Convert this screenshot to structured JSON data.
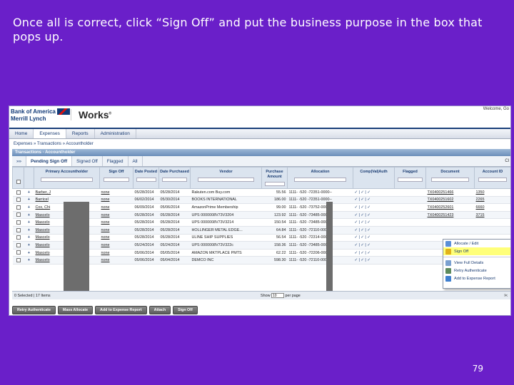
{
  "slide": {
    "title": "Once all is correct, click “Sign Off” and put the business purpose in the box that pops up.",
    "page_number": "79"
  },
  "app": {
    "bank_line1": "Bank of America",
    "bank_line2": "Merrill Lynch",
    "product": "Works",
    "product_mark": "®",
    "welcome": "Welcome, Go"
  },
  "nav": [
    "Home",
    "Expenses",
    "Reports",
    "Administration"
  ],
  "breadcrumb": "Expenses  »  Transactions  »  Accountholder",
  "panel_title": "Transactions - Accountholder",
  "tabs": [
    "»»",
    "Pending Sign Off",
    "Signed Off",
    "Flagged",
    "All"
  ],
  "close_label": "Cl",
  "columns": [
    "",
    "",
    "Primary Accountholder",
    "Sign Off",
    "Date Posted",
    "Date Purchased",
    "Vendor",
    "Purchase Amount",
    "Allocation",
    "Comp|Val|Auth",
    "Flagged",
    "Document",
    "Account ID"
  ],
  "rows": [
    {
      "name": "Barber, J",
      "sign": "none",
      "posted": "05/28/2014",
      "purchased": "05/28/2014",
      "vendor": "Rakuten.com Buy.com",
      "amount": "55.56",
      "alloc": "1111-  -520   -72351-0000--",
      "cva": "✓ | ✓ | ✓",
      "doc": "TX0400251466",
      "acct": "1350"
    },
    {
      "name": "Barricel",
      "sign": "none",
      "posted": "06/02/2014",
      "purchased": "05/30/2014",
      "vendor": "BOOKS INTERNATIONAL",
      "amount": "186.00",
      "alloc": "1111-  -520   -72351-0000--",
      "cva": "✓ | ✓ | ✓",
      "doc": "TX0400251602",
      "acct": "2265"
    },
    {
      "name": "Cox, Chi",
      "sign": "none",
      "posted": "06/09/2014",
      "purchased": "05/06/2014",
      "vendor": "AmazonPrime Membership",
      "amount": "99.00",
      "alloc": "1111-  -520   -73752-0000--",
      "cva": "✓ | ✓ | ✓",
      "doc": "TX0400252601",
      "acct": "6660"
    },
    {
      "name": "Mascelo",
      "sign": "none",
      "posted": "05/28/2014",
      "purchased": "05/28/2014",
      "vendor": "UPS 0000008V73V3204",
      "amount": "123.92",
      "alloc": "1111-  -520   -73485-0000--",
      "cva": "✓ | ✓ | ✓",
      "doc": "TX0400251423",
      "acct": "3715"
    },
    {
      "name": "Mascelo",
      "sign": "none",
      "posted": "05/28/2014",
      "purchased": "05/28/2014",
      "vendor": "UPS 0000008V73V3214",
      "amount": "150.54",
      "alloc": "1111-  -520   -73485-0000--",
      "cva": "✓ | ✓ | ✓",
      "doc": "",
      "acct": ""
    },
    {
      "name": "Mascelo",
      "sign": "none",
      "posted": "05/28/2014",
      "purchased": "05/28/2014",
      "vendor": "HOLLINGER METAL EDGE...",
      "amount": "64.84",
      "alloc": "1111-  -520   -72110-0000--",
      "cva": "✓ | ✓ | ✓",
      "doc": "",
      "acct": ""
    },
    {
      "name": "Mascelo",
      "sign": "none",
      "posted": "05/28/2014",
      "purchased": "05/28/2014",
      "vendor": "ULINE SHIP SUPPLIES",
      "amount": "56.54",
      "alloc": "1111-  -520   -72314-0000--",
      "cva": "✓ | ✓ | ✓",
      "doc": "",
      "acct": ""
    },
    {
      "name": "Mascelo",
      "sign": "none",
      "posted": "05/24/2014",
      "purchased": "05/24/2014",
      "vendor": "UPS 0000008V73V322c",
      "amount": "158.36",
      "alloc": "1111-  -520   -73485-0000--",
      "cva": "✓ | ✓ | ✓",
      "doc": "",
      "acct": ""
    },
    {
      "name": "Mascelo",
      "sign": "none",
      "posted": "05/06/2014",
      "purchased": "05/05/2014",
      "vendor": "AMAZON MKTPLACE PMTS",
      "amount": "62.22",
      "alloc": "1111-  -520   -72206-0000--",
      "cva": "✓ | ✓ | ✓",
      "doc": "",
      "acct": ""
    },
    {
      "name": "Mascelo",
      "sign": "none",
      "posted": "05/06/2014",
      "purchased": "05/04/2014",
      "vendor": "DEMCO INC",
      "amount": "598.30",
      "alloc": "1111-  -520   -72110-0000--",
      "cva": "✓ | ✓ | ✓",
      "doc": "",
      "acct": ""
    }
  ],
  "context_menu": [
    {
      "label": "Allocate / Edit",
      "color": "#5a8fd8",
      "icon": "pencil-icon"
    },
    {
      "label": "Sign Off",
      "color": "#e2b21b",
      "icon": "sign-off-icon",
      "highlight": true
    },
    {
      "label": "View Full Details",
      "color": "#7aa0d0",
      "icon": "details-icon"
    },
    {
      "label": "Retry Authenticate",
      "color": "#5c8a5c",
      "icon": "retry-icon"
    },
    {
      "label": "Add to Expense Report",
      "color": "#3f7fcf",
      "icon": "report-icon"
    }
  ],
  "footer": {
    "selected": "0 Selected  |  17 Items",
    "show_label": "Show",
    "show_value": "10",
    "per_page": "per page",
    "right_mark": "I<"
  },
  "actions": [
    "Retry Authenticate",
    "Mass Allocate",
    "Add to Expense Report",
    "Attach",
    "Sign Off"
  ]
}
